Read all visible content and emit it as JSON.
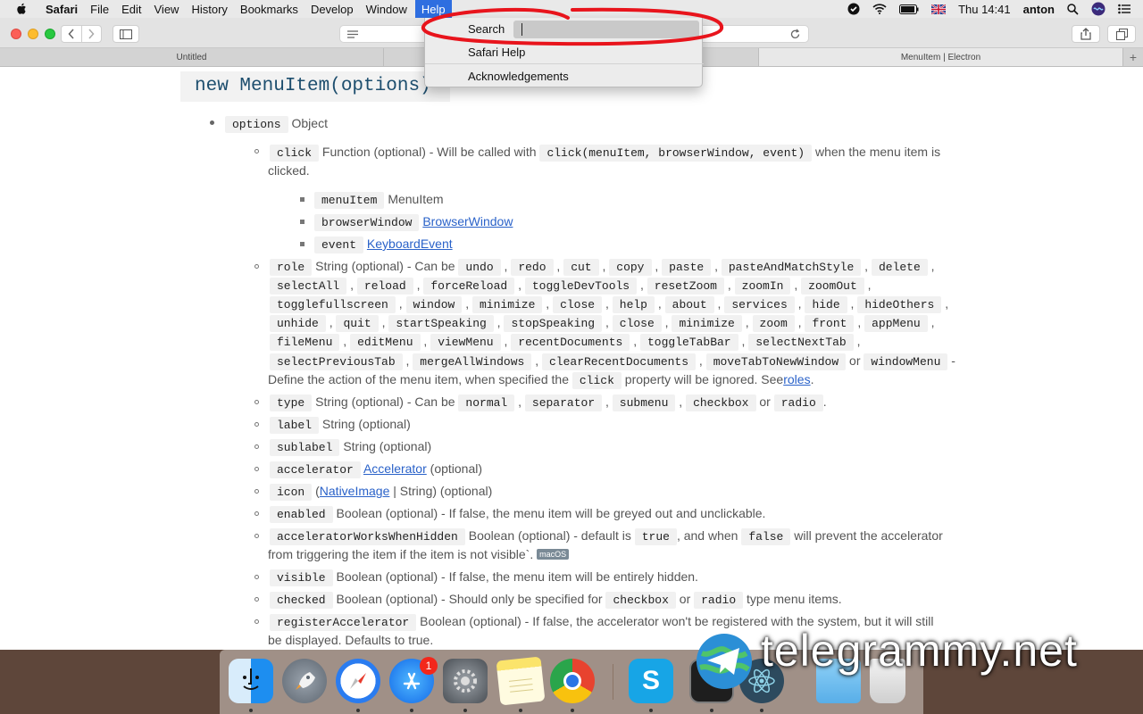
{
  "menubar": {
    "app": "Safari",
    "items": [
      "File",
      "Edit",
      "View",
      "History",
      "Bookmarks",
      "Develop",
      "Window"
    ],
    "help": "Help",
    "clock": "Thu 14:41",
    "user": "anton"
  },
  "tabs": {
    "left": "Untitled",
    "right": "MenuItem | Electron"
  },
  "help_menu": {
    "search_label": "Search",
    "search_value": "",
    "item1": "Safari Help",
    "item2": "Acknowledgements"
  },
  "doc": {
    "heading": "new MenuItem(options)",
    "options_code": "options",
    "options_type": "Object",
    "click": {
      "code": "click",
      "desc": "Function (optional) - Will be called with",
      "sig": "click(menuItem, browserWindow, event)",
      "desc2": "when the menu item is",
      "desc3": "clicked."
    },
    "menuItem": {
      "code": "menuItem",
      "type": "MenuItem"
    },
    "browserWindow": {
      "code": "browserWindow",
      "type": "BrowserWindow"
    },
    "event": {
      "code": "event",
      "type": "KeyboardEvent"
    },
    "role": {
      "code": "role",
      "desc": "String (optional) - Can be",
      "row1": [
        "undo",
        "redo",
        "cut",
        "copy",
        "paste",
        "pasteAndMatchStyle",
        "delete"
      ],
      "row2": [
        "selectAll",
        "reload",
        "forceReload",
        "toggleDevTools",
        "resetZoom",
        "zoomIn",
        "zoomOut"
      ],
      "row3": [
        "togglefullscreen",
        "window",
        "minimize",
        "close",
        "help",
        "about",
        "services",
        "hide",
        "hideOthers"
      ],
      "row4": [
        "unhide",
        "quit",
        "startSpeaking",
        "stopSpeaking",
        "close",
        "minimize",
        "zoom",
        "front",
        "appMenu"
      ],
      "row5": [
        "fileMenu",
        "editMenu",
        "viewMenu",
        "recentDocuments",
        "toggleTabBar",
        "selectNextTab"
      ],
      "row6a": [
        "selectPreviousTab",
        "mergeAllWindows",
        "clearRecentDocuments",
        "moveTabToNewWindow"
      ],
      "or": "or",
      "row6b": "windowMenu",
      "dash": "-",
      "tail1": "Define the action of the menu item, when specified the",
      "tail_code": "click",
      "tail2": "property will be ignored. See",
      "tail_link": "roles",
      "tail_end": "."
    },
    "type": {
      "code": "type",
      "desc": "String (optional) - Can be",
      "values": [
        "normal",
        "separator",
        "submenu",
        "checkbox"
      ],
      "or": "or",
      "last": "radio",
      "end": "."
    },
    "label": {
      "code": "label",
      "desc": "String (optional)"
    },
    "sublabel": {
      "code": "sublabel",
      "desc": "String (optional)"
    },
    "accelerator": {
      "code": "accelerator",
      "link": "Accelerator",
      "desc": "(optional)"
    },
    "icon": {
      "code": "icon",
      "pre": "(",
      "link": "NativeImage",
      "desc": "| String) (optional)"
    },
    "enabled": {
      "code": "enabled",
      "desc": "Boolean (optional) - If false, the menu item will be greyed out and unclickable."
    },
    "awwh": {
      "code": "acceleratorWorksWhenHidden",
      "desc": "Boolean (optional) - default is",
      "true": "true",
      "mid": ", and when",
      "false": "false",
      "desc2": "will prevent the accelerator",
      "desc3": "from triggering the item if the item is not visible`.",
      "badge": "macOS"
    },
    "visible": {
      "code": "visible",
      "desc": "Boolean (optional) - If false, the menu item will be entirely hidden."
    },
    "checked": {
      "code": "checked",
      "desc": "Boolean (optional) - Should only be specified for",
      "c1": "checkbox",
      "or": "or",
      "c2": "radio",
      "desc2": "type menu items."
    },
    "registerAccelerator": {
      "code": "registerAccelerator",
      "desc": "Boolean (optional) - If false, the accelerator won't be registered with the system, but it will still",
      "desc2": "be displayed. Defaults to true."
    }
  },
  "dock": {
    "apps": [
      "Finder",
      "Launchpad",
      "Safari",
      "App Store",
      "System Preferences",
      "Notes",
      "Chrome",
      "Skype",
      "Terminal",
      "Atom",
      "Folder",
      "Trash"
    ],
    "app_store_badge": "1"
  },
  "watermark": "telegrammy.net"
}
